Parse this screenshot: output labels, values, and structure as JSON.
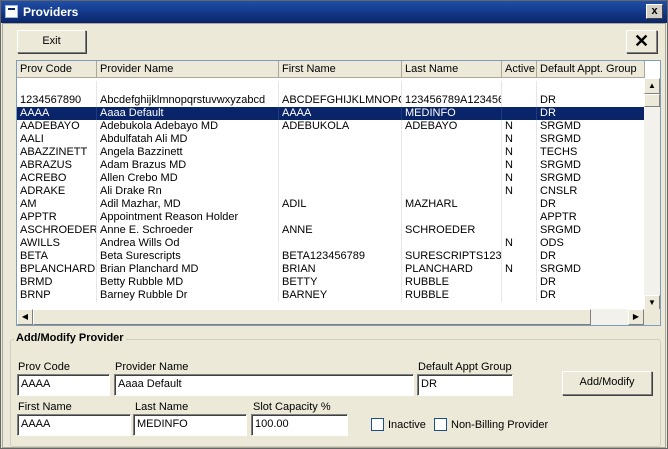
{
  "window": {
    "title": "Providers",
    "close_glyph": "x"
  },
  "toolbar": {
    "exit_label": "Exit",
    "close_glyph": "✕"
  },
  "grid": {
    "columns": [
      "Prov Code",
      "Provider Name",
      "First Name",
      "Last Name",
      "Active",
      "Default Appt. Group"
    ],
    "rows": [
      [
        "",
        "",
        "",
        "",
        "",
        ""
      ],
      [
        "1234567890",
        "Abcdefghijklmnopqrstuvwxyzabcd",
        "ABCDEFGHIJKLMNOPQ",
        "123456789A123456",
        "",
        "DR"
      ],
      [
        "AAAA",
        "Aaaa Default",
        "AAAA",
        "MEDINFO",
        "",
        "DR"
      ],
      [
        "AADEBAYO",
        "Adebukola Adebayo MD",
        "ADEBUKOLA",
        "ADEBAYO",
        "N",
        "SRGMD"
      ],
      [
        "AALI",
        "Abdulfatah Ali MD",
        "",
        "",
        "N",
        "SRGMD"
      ],
      [
        "ABAZZINETT",
        "Angela Bazzinett",
        "",
        "",
        "N",
        "TECHS"
      ],
      [
        "ABRAZUS",
        "Adam Brazus MD",
        "",
        "",
        "N",
        "SRGMD"
      ],
      [
        "ACREBO",
        "Allen Crebo MD",
        "",
        "",
        "N",
        "SRGMD"
      ],
      [
        "ADRAKE",
        "Ali Drake Rn",
        "",
        "",
        "N",
        "CNSLR"
      ],
      [
        "AM",
        "Adil Mazhar, MD",
        "ADIL",
        "MAZHARL",
        "",
        "DR"
      ],
      [
        "APPTR",
        "Appointment Reason Holder",
        "",
        "",
        "",
        "APPTR"
      ],
      [
        "ASCHROEDER",
        "Anne E. Schroeder",
        "ANNE",
        "SCHROEDER",
        "",
        "SRGMD"
      ],
      [
        "AWILLS",
        "Andrea Wills Od",
        "",
        "",
        "N",
        "ODS"
      ],
      [
        "BETA",
        "Beta Surescripts",
        "BETA123456789",
        "SURESCRIPTS123",
        "",
        "DR"
      ],
      [
        "BPLANCHARD",
        "Brian Planchard MD",
        "BRIAN",
        "PLANCHARD",
        "N",
        "SRGMD"
      ],
      [
        "BRMD",
        "Betty Rubble MD",
        "BETTY",
        "RUBBLE",
        "",
        "DR"
      ],
      [
        "BRNP",
        "Barney Rubble Dr",
        "BARNEY",
        "RUBBLE",
        "",
        "DR"
      ]
    ],
    "selected_row": 2
  },
  "form": {
    "title": "Add/Modify Provider",
    "prov_code_label": "Prov Code",
    "prov_code_value": "AAAA",
    "provider_name_label": "Provider Name",
    "provider_name_value": "Aaaa Default",
    "default_appt_group_label": "Default Appt Group",
    "default_appt_group_value": "DR",
    "add_modify_label": "Add/Modify",
    "first_name_label": "First Name",
    "first_name_value": "AAAA",
    "last_name_label": "Last Name",
    "last_name_value": "MEDINFO",
    "slot_capacity_label": "Slot Capacity %",
    "slot_capacity_value": "100.00",
    "inactive_label": "Inactive",
    "inactive_checked": false,
    "non_billing_label": "Non-Billing Provider",
    "non_billing_checked": false
  }
}
